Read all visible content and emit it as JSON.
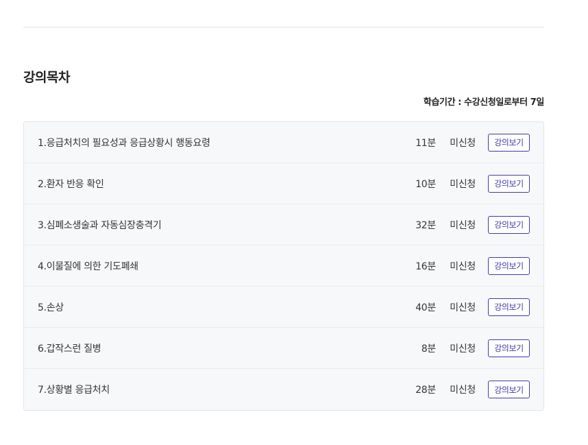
{
  "section": {
    "title": "강의목차",
    "study_period": "학습기간 : 수강신청일로부터 7일"
  },
  "lectures": [
    {
      "title": "1.응급처치의 필요성과 응급상황시 행동요령",
      "duration": "11분",
      "status": "미신청",
      "button": "강의보기"
    },
    {
      "title": "2.환자 반응 확인",
      "duration": "10분",
      "status": "미신청",
      "button": "강의보기"
    },
    {
      "title": "3.심폐소생술과 자동심장충격기",
      "duration": "32분",
      "status": "미신청",
      "button": "강의보기"
    },
    {
      "title": "4.이물질에 의한 기도폐쇄",
      "duration": "16분",
      "status": "미신청",
      "button": "강의보기"
    },
    {
      "title": "5.손상",
      "duration": "40분",
      "status": "미신청",
      "button": "강의보기"
    },
    {
      "title": "6.갑작스런 질병",
      "duration": "8분",
      "status": "미신청",
      "button": "강의보기"
    },
    {
      "title": "7.상황별 응급처치",
      "duration": "28분",
      "status": "미신청",
      "button": "강의보기"
    }
  ],
  "colors": {
    "accent": "#3d3aa8",
    "list_background": "#f7f8fa",
    "border": "#e3e5e8"
  }
}
